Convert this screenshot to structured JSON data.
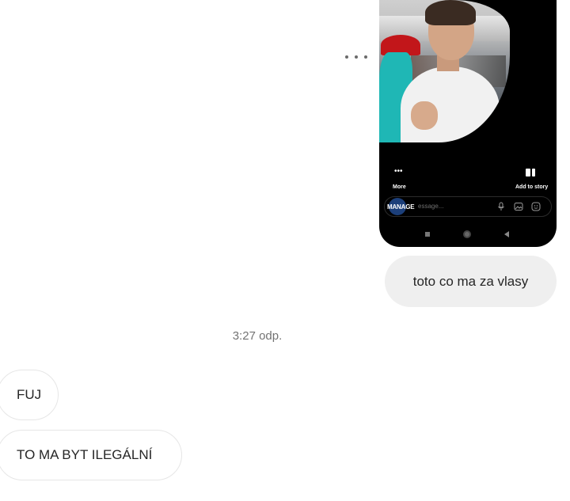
{
  "shared_screenshot": {
    "controls": {
      "more_label": "More",
      "add_to_story_label": "Add to story"
    },
    "message_bar": {
      "manage_label": "MANAGE",
      "placeholder_visible": "essage..."
    }
  },
  "messages": {
    "outgoing": [
      {
        "text": "toto co ma za vlasy"
      }
    ],
    "timestamp": "3:27 odp.",
    "incoming": [
      {
        "text": "FUJ"
      },
      {
        "text": "TO MA BYT ILEGÁLNÍ"
      }
    ]
  },
  "colors": {
    "outgoing_bubble": "#efefef",
    "incoming_border": "#e6e6e6",
    "timestamp_text": "#737373",
    "message_text": "#262626"
  }
}
